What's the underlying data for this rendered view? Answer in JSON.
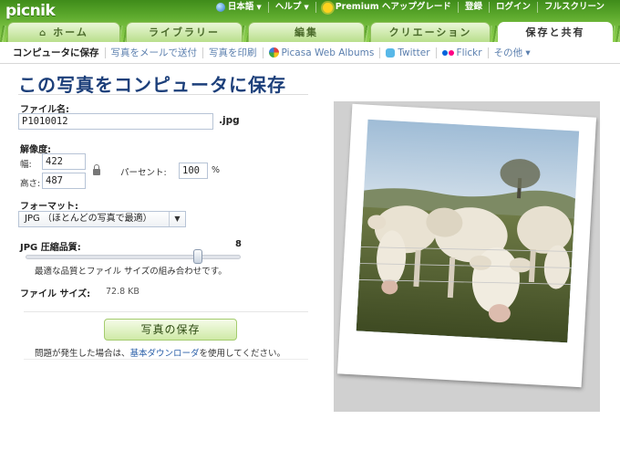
{
  "app": {
    "logo": "picnik"
  },
  "toplinks": [
    {
      "label": "日本語",
      "icon": "globe-icon",
      "caret": true
    },
    {
      "label": "ヘルプ",
      "icon": null,
      "caret": true
    },
    {
      "label": "Premium ヘアップグレード",
      "icon": "sun-icon",
      "caret": false
    },
    {
      "label": "登録",
      "icon": null,
      "caret": false
    },
    {
      "label": "ログイン",
      "icon": null,
      "caret": false
    },
    {
      "label": "フルスクリーン",
      "icon": null,
      "caret": false
    }
  ],
  "tabs": [
    {
      "label": "ホーム",
      "icon": "home-icon",
      "active": false
    },
    {
      "label": "ライブラリー",
      "active": false
    },
    {
      "label": "編集",
      "active": false
    },
    {
      "label": "クリエーション",
      "active": false
    },
    {
      "label": "保存と共有",
      "active": true
    }
  ],
  "subnav": [
    {
      "label": "コンピュータに保存",
      "active": true
    },
    {
      "label": "写真をメールで送付"
    },
    {
      "label": "写真を印刷"
    },
    {
      "label": "Picasa Web Albums",
      "icon": "picasa-icon"
    },
    {
      "label": "Twitter",
      "icon": "twitter-icon"
    },
    {
      "label": "Flickr",
      "icon": "flickr-icon"
    },
    {
      "label": "その他 ▾"
    }
  ],
  "page": {
    "title": "この写真をコンピュータに保存",
    "filename_label": "ファイル名:",
    "filename_value": "P1010012",
    "extension": ".jpg",
    "resolution_label": "解像度:",
    "width_label": "幅:",
    "width_value": "422",
    "height_label": "高さ:",
    "height_value": "487",
    "percent_label": "パーセント:",
    "percent_value": "100",
    "percent_unit": "%",
    "format_label": "フォーマット:",
    "format_value": "JPG （ほとんどの写真で最適）",
    "quality_label": "JPG 圧縮品質:",
    "quality_value": "8",
    "quality_max": 10,
    "quality_hint": "最適な品質とファイル サイズの組み合わせです。",
    "filesize_label": "ファイル サイズ:",
    "filesize_value": "72.8 KB",
    "save_button": "写真の保存",
    "help_prefix": "問題が発生した場合は、",
    "help_link": "基本ダウンローダ",
    "help_suffix": "を使用してください。"
  },
  "colors": {
    "accent_green": "#7cc243",
    "title_blue": "#1c3f7a",
    "link_blue": "#2a5fa8"
  }
}
